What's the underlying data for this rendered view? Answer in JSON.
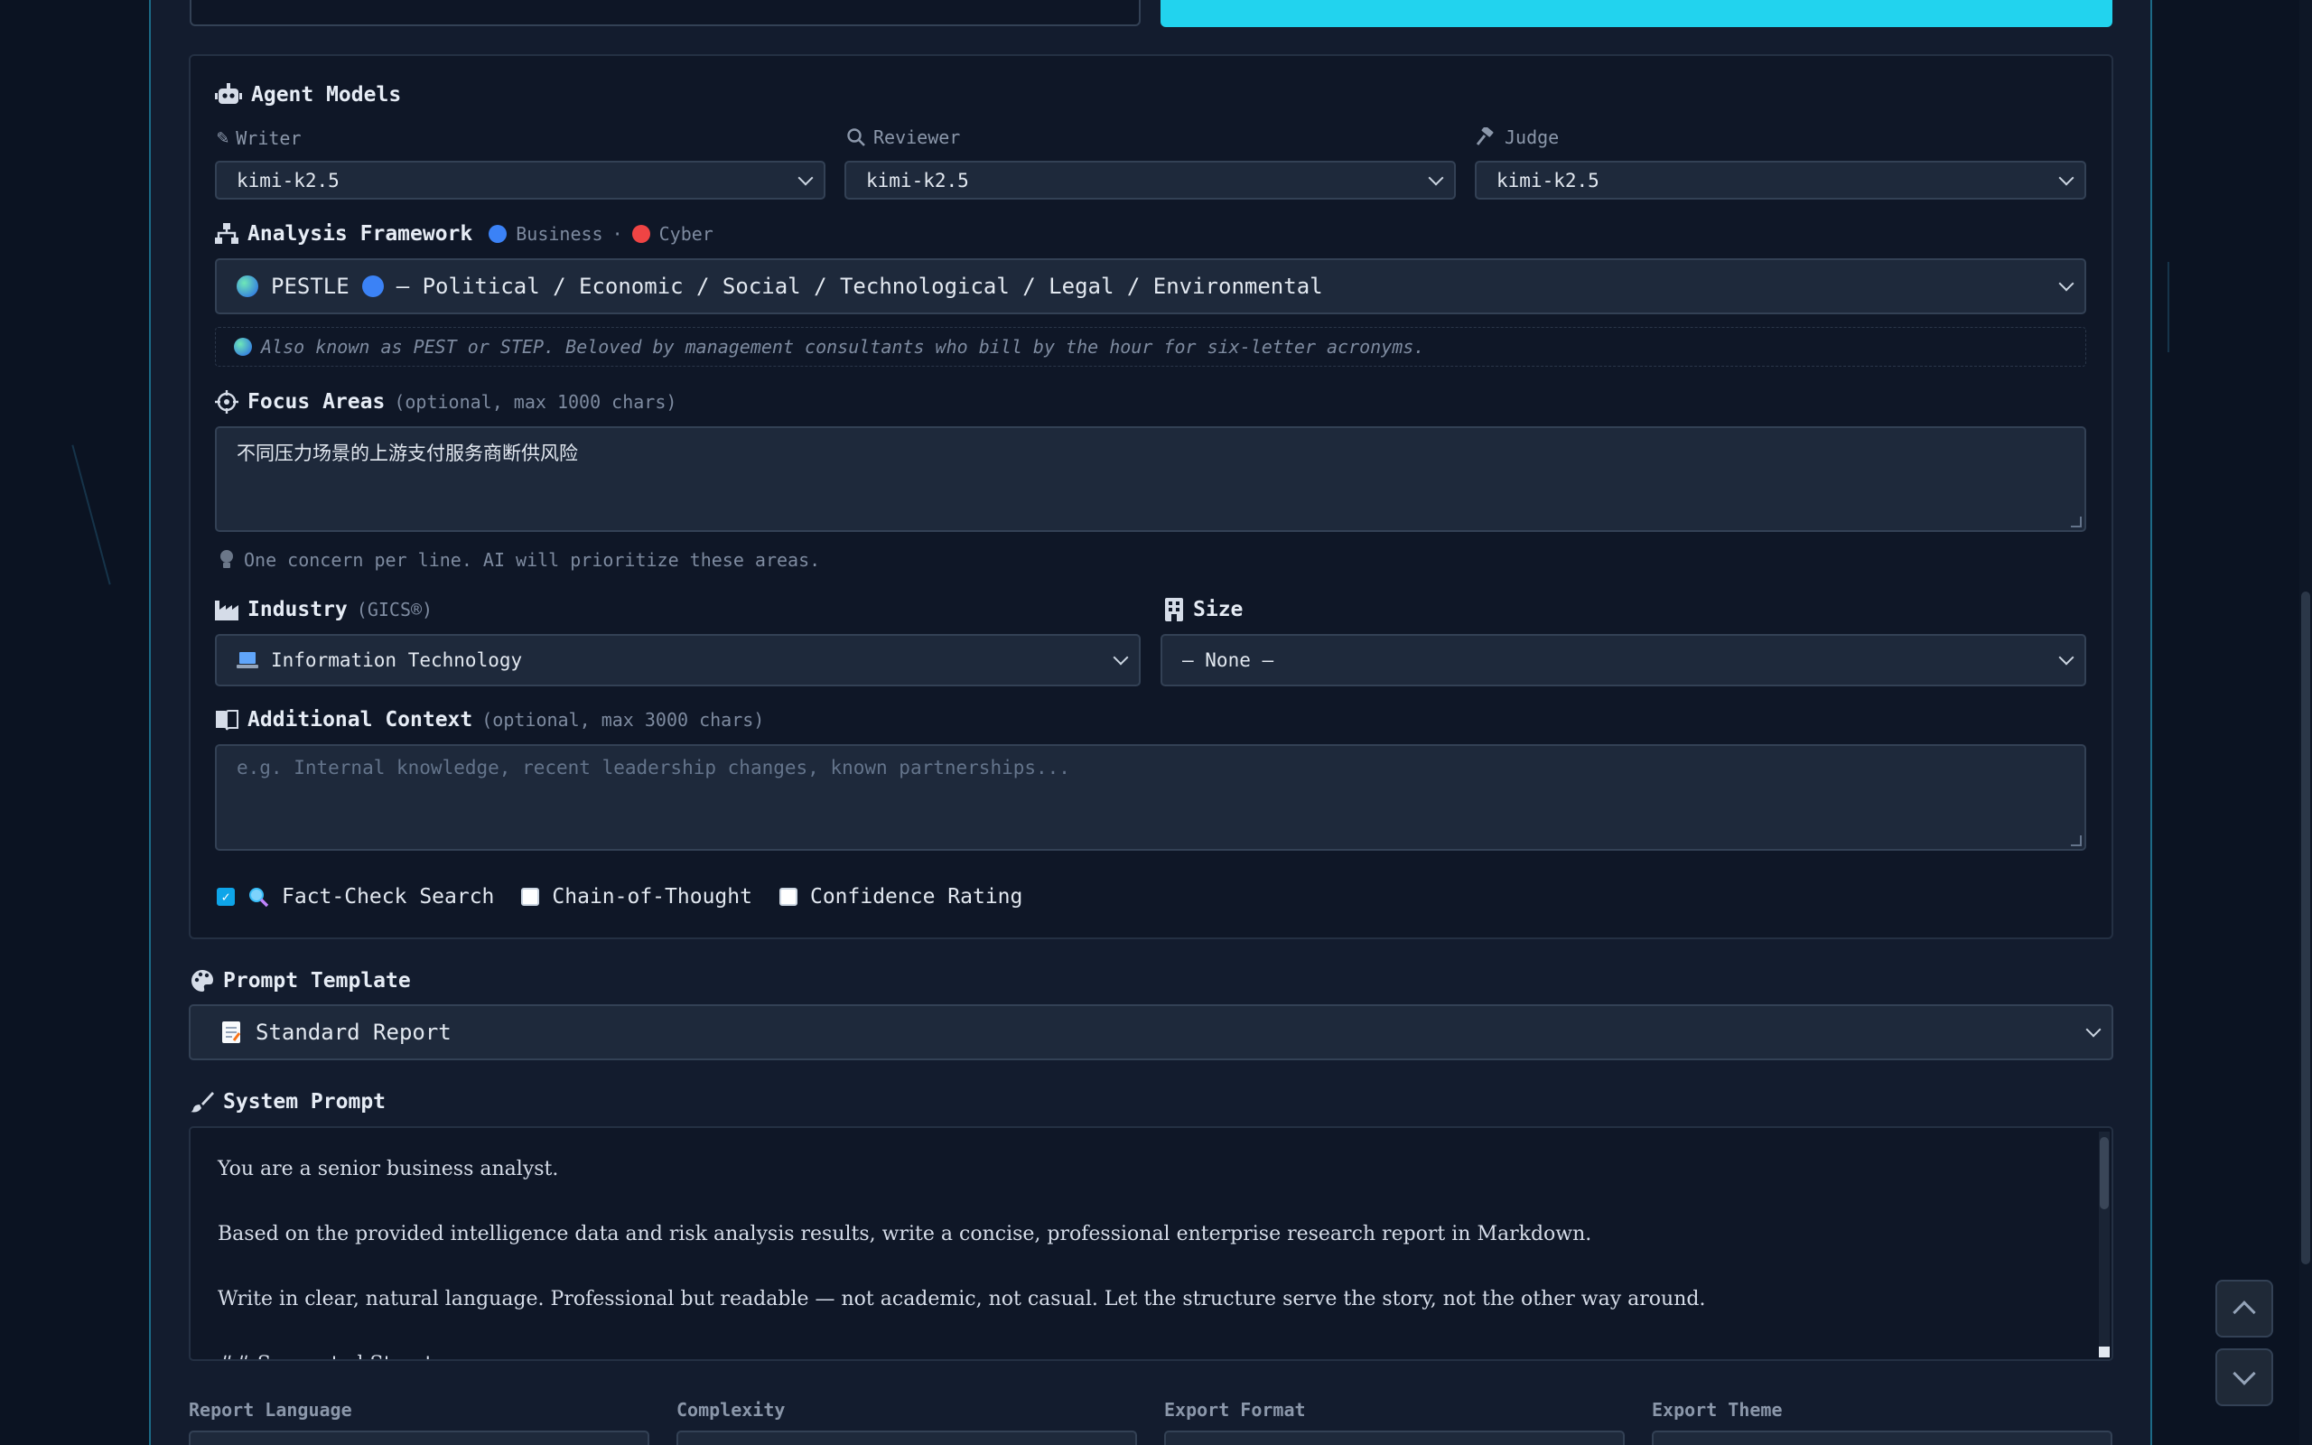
{
  "agent_models": {
    "title": "Agent Models",
    "writer": {
      "label": "Writer",
      "value": "kimi-k2.5"
    },
    "reviewer": {
      "label": "Reviewer",
      "value": "kimi-k2.5"
    },
    "judge": {
      "label": "Judge",
      "value": "kimi-k2.5"
    }
  },
  "framework": {
    "title": "Analysis Framework",
    "legend_business": "Business",
    "legend_sep": "·",
    "legend_cyber": "Cyber",
    "selected_name": "PESTLE",
    "selected_desc": "— Political / Economic / Social / Technological / Legal / Environmental",
    "hint": "Also known as PEST or STEP. Beloved by management consultants who bill by the hour for six-letter acronyms."
  },
  "focus": {
    "title": "Focus Areas",
    "sub": "(optional, max 1000 chars)",
    "value": "不同压力场景的上游支付服务商断供风险",
    "hint": "One concern per line. AI will prioritize these areas."
  },
  "industry": {
    "title": "Industry",
    "sub": "(GICS®)",
    "value": "Information Technology"
  },
  "size": {
    "title": "Size",
    "value": "— None —"
  },
  "context": {
    "title": "Additional Context",
    "sub": "(optional, max 3000 chars)",
    "placeholder": "e.g. Internal knowledge, recent leadership changes, known partnerships..."
  },
  "options": {
    "fact_check": "Fact-Check Search",
    "chain_of_thought": "Chain-of-Thought",
    "confidence": "Confidence Rating"
  },
  "template": {
    "title": "Prompt Template",
    "value": "Standard Report"
  },
  "system_prompt": {
    "title": "System Prompt",
    "line1": "You are a senior business analyst.",
    "line2": "Based on the provided intelligence data and risk analysis results, write a concise, professional enterprise research report in Markdown.",
    "line3": "Write in clear, natural language. Professional but readable — not academic, not casual. Let the structure serve the story, not the other way around.",
    "line4": "## Suggested Structure"
  },
  "bottom_labels": {
    "language": "Report Language",
    "complexity": "Complexity",
    "format": "Export Format",
    "theme": "Export Theme"
  },
  "colors": {
    "accent": "#22d3ee",
    "business_dot": "#3b82f6",
    "cyber_dot": "#ef4444"
  }
}
